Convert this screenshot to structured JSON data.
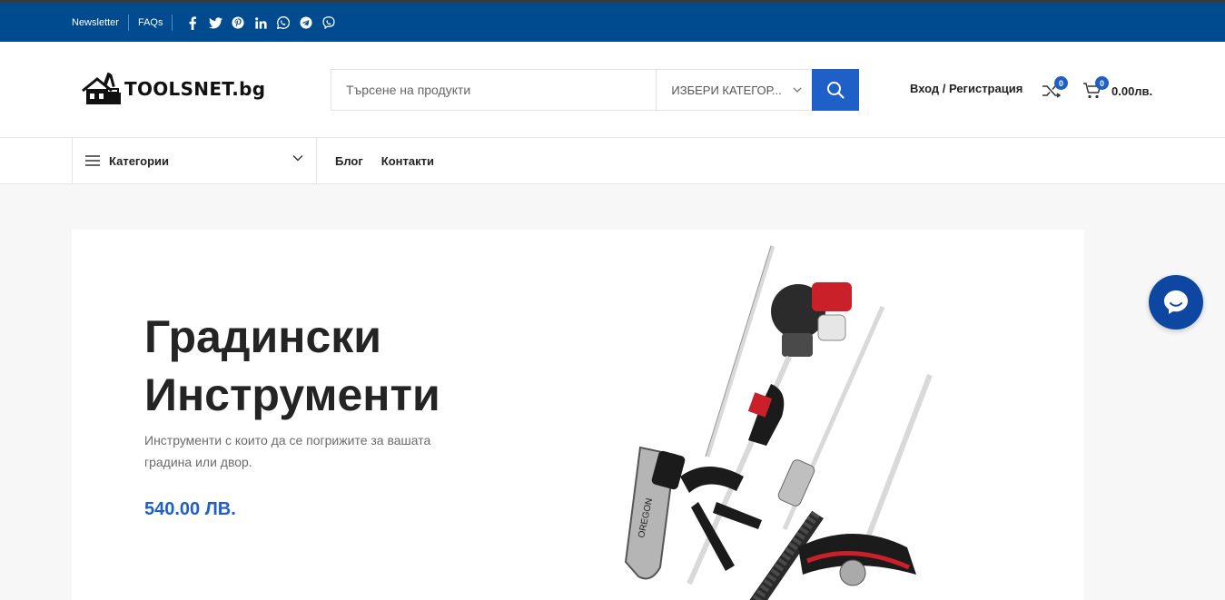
{
  "topbar": {
    "links": [
      "Newsletter",
      "FAQs"
    ],
    "social_icons": [
      "facebook-icon",
      "twitter-icon",
      "pinterest-icon",
      "linkedin-icon",
      "whatsapp-icon",
      "telegram-icon",
      "viber-icon"
    ]
  },
  "header": {
    "logo_text": "TOOLSNET.bg",
    "search_placeholder": "Търсене на продукти",
    "category_select": "ИЗБЕРИ КАТЕГОР...",
    "account_label": "Вход / Регистрация",
    "compare_count": "0",
    "cart_count": "0",
    "cart_total": "0.00лв."
  },
  "nav": {
    "categories_label": "Категории",
    "menu": [
      "Блог",
      "Контакти"
    ]
  },
  "hero": {
    "title_line1": "Градински",
    "title_line2": "Инструменти",
    "description": "Инструменти с които да се погрижите за вашата градина или двор.",
    "price": "540.00 ЛВ."
  },
  "colors": {
    "topbar": "#004a8f",
    "accent": "#1f5fc8",
    "chat": "#0d47a1"
  }
}
